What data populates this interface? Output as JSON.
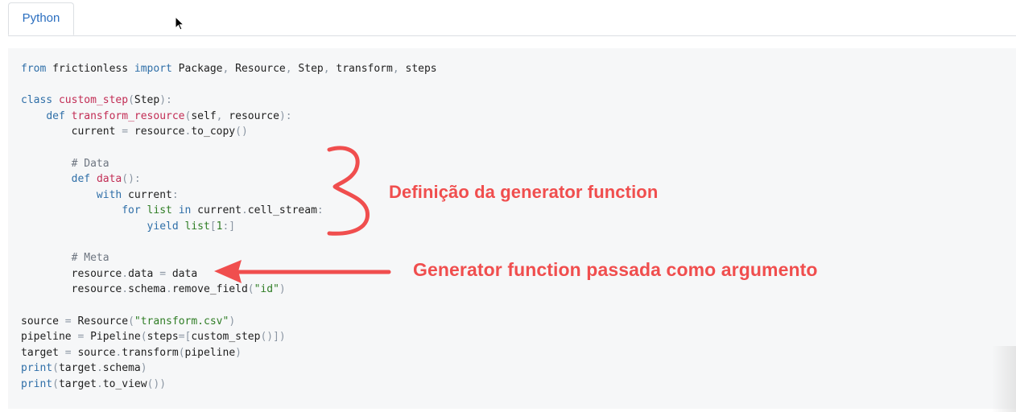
{
  "tabs": [
    {
      "label": "Python"
    }
  ],
  "code": {
    "language": "Python",
    "lines": [
      [
        [
          "k",
          "from"
        ],
        [
          "n",
          " frictionless "
        ],
        [
          "k",
          "import"
        ],
        [
          "n",
          " Package"
        ],
        [
          "p",
          ","
        ],
        [
          "n",
          " Resource"
        ],
        [
          "p",
          ","
        ],
        [
          "n",
          " Step"
        ],
        [
          "p",
          ","
        ],
        [
          "n",
          " transform"
        ],
        [
          "p",
          ","
        ],
        [
          "n",
          " steps"
        ]
      ],
      [],
      [
        [
          "k",
          "class"
        ],
        [
          "n",
          " "
        ],
        [
          "f",
          "custom_step"
        ],
        [
          "p",
          "("
        ],
        [
          "n",
          "Step"
        ],
        [
          "p",
          "):"
        ]
      ],
      [
        [
          "n",
          "    "
        ],
        [
          "k",
          "def"
        ],
        [
          "n",
          " "
        ],
        [
          "f",
          "transform_resource"
        ],
        [
          "p",
          "("
        ],
        [
          "n",
          "self"
        ],
        [
          "p",
          ","
        ],
        [
          "n",
          " resource"
        ],
        [
          "p",
          "):"
        ]
      ],
      [
        [
          "n",
          "        current "
        ],
        [
          "p",
          "="
        ],
        [
          "n",
          " resource"
        ],
        [
          "p",
          "."
        ],
        [
          "n",
          "to_copy"
        ],
        [
          "p",
          "()"
        ]
      ],
      [],
      [
        [
          "n",
          "        "
        ],
        [
          "c",
          "# Data"
        ]
      ],
      [
        [
          "n",
          "        "
        ],
        [
          "k",
          "def"
        ],
        [
          "n",
          " "
        ],
        [
          "f",
          "data"
        ],
        [
          "p",
          "():"
        ]
      ],
      [
        [
          "n",
          "            "
        ],
        [
          "k",
          "with"
        ],
        [
          "n",
          " current"
        ],
        [
          "p",
          ":"
        ]
      ],
      [
        [
          "n",
          "                "
        ],
        [
          "k",
          "for"
        ],
        [
          "n",
          " "
        ],
        [
          "s",
          "list"
        ],
        [
          "n",
          " "
        ],
        [
          "k",
          "in"
        ],
        [
          "n",
          " current"
        ],
        [
          "p",
          "."
        ],
        [
          "n",
          "cell_stream"
        ],
        [
          "p",
          ":"
        ]
      ],
      [
        [
          "n",
          "                    "
        ],
        [
          "k",
          "yield"
        ],
        [
          "n",
          " "
        ],
        [
          "s",
          "list"
        ],
        [
          "p",
          "["
        ],
        [
          "s",
          "1"
        ],
        [
          "p",
          ":]"
        ]
      ],
      [],
      [
        [
          "n",
          "        "
        ],
        [
          "c",
          "# Meta"
        ]
      ],
      [
        [
          "n",
          "        resource"
        ],
        [
          "p",
          "."
        ],
        [
          "n",
          "data "
        ],
        [
          "p",
          "="
        ],
        [
          "n",
          " data"
        ]
      ],
      [
        [
          "n",
          "        resource"
        ],
        [
          "p",
          "."
        ],
        [
          "n",
          "schema"
        ],
        [
          "p",
          "."
        ],
        [
          "n",
          "remove_field"
        ],
        [
          "p",
          "("
        ],
        [
          "s",
          "\"id\""
        ],
        [
          "p",
          ")"
        ]
      ],
      [],
      [
        [
          "n",
          "source "
        ],
        [
          "p",
          "="
        ],
        [
          "n",
          " Resource"
        ],
        [
          "p",
          "("
        ],
        [
          "s",
          "\"transform.csv\""
        ],
        [
          "p",
          ")"
        ]
      ],
      [
        [
          "n",
          "pipeline "
        ],
        [
          "p",
          "="
        ],
        [
          "n",
          " Pipeline"
        ],
        [
          "p",
          "("
        ],
        [
          "n",
          "steps"
        ],
        [
          "p",
          "=["
        ],
        [
          "n",
          "custom_step"
        ],
        [
          "p",
          "()])"
        ]
      ],
      [
        [
          "n",
          "target "
        ],
        [
          "p",
          "="
        ],
        [
          "n",
          " source"
        ],
        [
          "p",
          "."
        ],
        [
          "n",
          "transform"
        ],
        [
          "p",
          "("
        ],
        [
          "n",
          "pipeline"
        ],
        [
          "p",
          ")"
        ]
      ],
      [
        [
          "k",
          "print"
        ],
        [
          "p",
          "("
        ],
        [
          "n",
          "target"
        ],
        [
          "p",
          "."
        ],
        [
          "n",
          "schema"
        ],
        [
          "p",
          ")"
        ]
      ],
      [
        [
          "k",
          "print"
        ],
        [
          "p",
          "("
        ],
        [
          "n",
          "target"
        ],
        [
          "p",
          "."
        ],
        [
          "n",
          "to_view"
        ],
        [
          "p",
          "())"
        ]
      ]
    ]
  },
  "annotations": {
    "brace_label": "Definição da generator function",
    "arrow_label": "Generator function passada como argumento",
    "color": "#f04e4e"
  },
  "icons": {
    "cursor": "mouse-pointer-icon"
  }
}
